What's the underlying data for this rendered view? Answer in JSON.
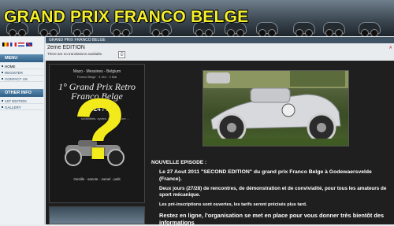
{
  "banner": {
    "title": "GRAND PRIX FRANCO BELGE"
  },
  "sidebar": {
    "flags": [
      "be-flag",
      "fr-flag",
      "nl-flag",
      "gb-flag"
    ],
    "menu_header": "MENU",
    "menu_items": [
      "HOME",
      "REGISTER",
      "CONTACT US"
    ],
    "other_header": "OTHER INFO",
    "other_items": [
      "1ST EDITION",
      "GALLERY"
    ]
  },
  "breadcrumb": "GRAND PRIX FRANCO BELGE",
  "page": {
    "title": "2eme EDITION",
    "no_translation": "There are no translations available.",
    "corner_char": "A"
  },
  "poster": {
    "line1": "Mazo - Messines - Belgium",
    "line2": "Franco Belge · 4 Jeu · 4 Mai",
    "title": "1° Grand Prix Retro Franco Belge",
    "date": "23 - 24 / 10",
    "sub": "scrambles, cycles, fitness, more ...",
    "footer": "Gesille · sancte · Jumel · pelit"
  },
  "news": {
    "heading": "NOUVELLE EPISODE :",
    "p1": "Le 27 Aout 2011 \"SECOND EDITION\" du grand prix Franco Belge à Godewaersvelde (France).",
    "p2": "Deux jours (27/28) de rencontres, de démonstration et de convivialité, pour tous les amateurs de sport mécanique.",
    "p3": "Les pré-inscriptions sont ouvertes, les tarifs seront précisés plus tard.",
    "p4": "Restez en ligne, l'organisation se met en place pour vous donner très bientôt des informations"
  },
  "colors": {
    "banner_title": "#f4ef2a",
    "sidebar_header": "#2f5f86",
    "content_bg": "#1f1f1f",
    "question_mark": "#f3ea1c"
  }
}
